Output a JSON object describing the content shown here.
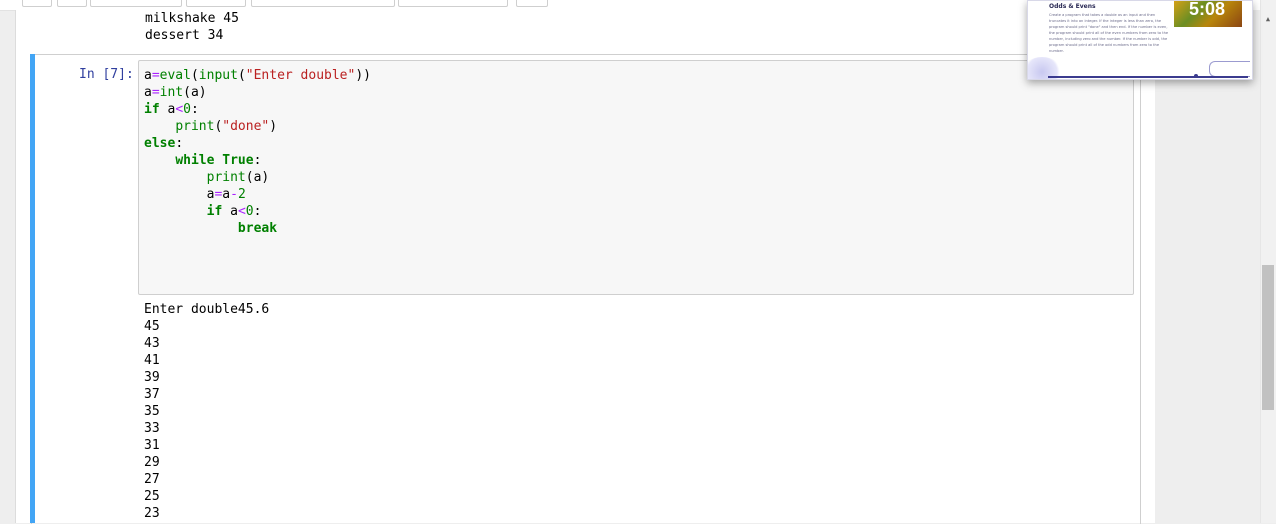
{
  "previous_output": [
    "milkshake 45",
    "dessert 34"
  ],
  "cell": {
    "prompt": "In [7]:",
    "code_lines": [
      "a=eval(input(\"Enter double\"))",
      "a=int(a)",
      "if a<0:",
      "    print(\"done\")",
      "else:",
      "    while True:",
      "        print(a)",
      "        a=a-2",
      "        if a<0:",
      "            break"
    ],
    "output_lines": [
      "Enter double45.6",
      "45",
      "43",
      "41",
      "39",
      "37",
      "35",
      "33",
      "31",
      "29",
      "27",
      "25",
      "23"
    ]
  },
  "overlay": {
    "title": "Odds & Evens",
    "description": "Create a program that takes a double as an input and then truncates it into an integer. If the integer is less than zero, the program should print \"done\" and then end. If the number is even, the program should print all of the even numbers from zero to the number, including zero and the number. If the number is odd, the program should print all of the odd numbers from zero to the number.",
    "time": "5:08"
  },
  "colors": {
    "cell_bar": "#42a5f5",
    "prompt": "#303f9f",
    "keyword": "#008000",
    "string": "#ba2121"
  }
}
